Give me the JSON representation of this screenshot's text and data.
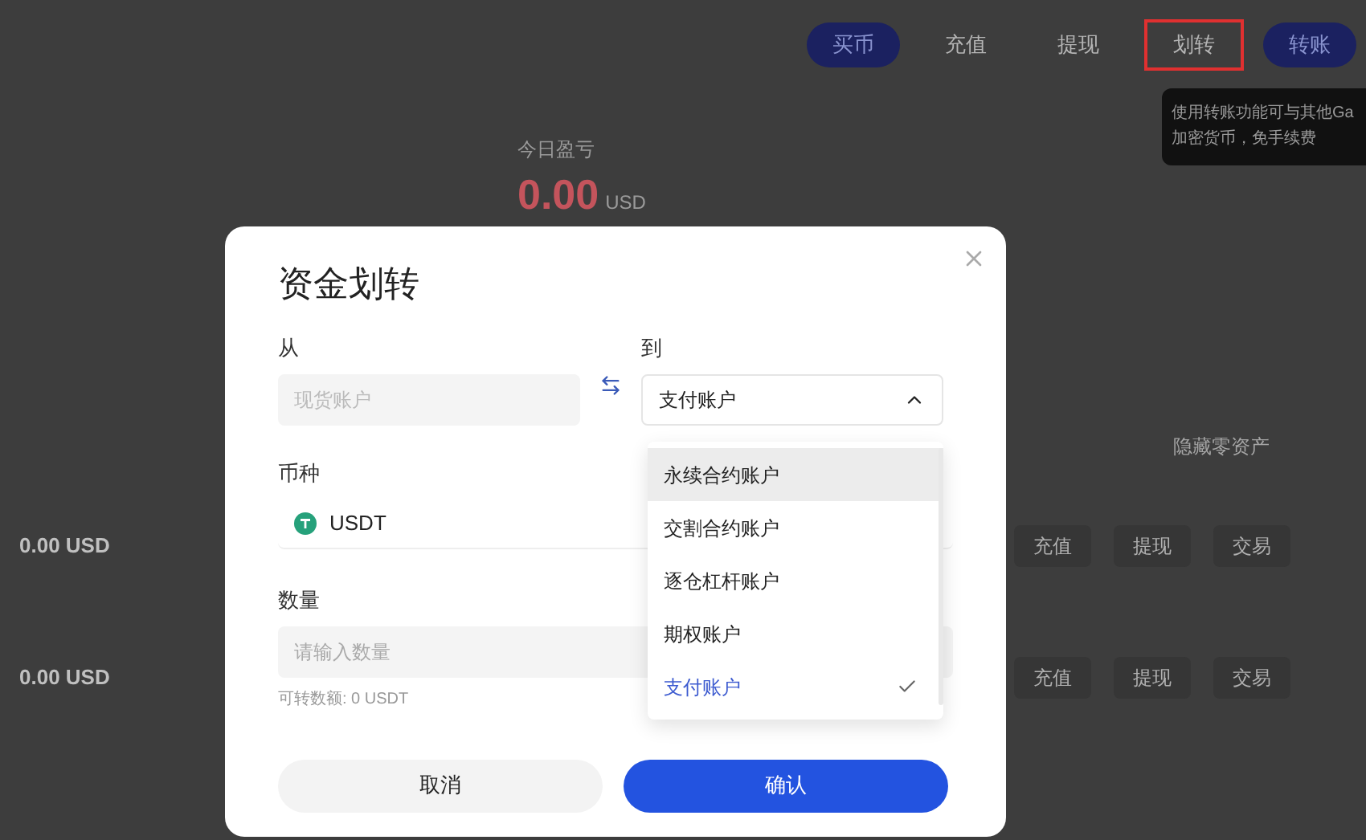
{
  "top_actions": [
    {
      "label": "买币",
      "kind": "primary",
      "highlighted": false
    },
    {
      "label": "充值",
      "kind": "plain",
      "highlighted": false
    },
    {
      "label": "提现",
      "kind": "plain",
      "highlighted": false
    },
    {
      "label": "划转",
      "kind": "plain",
      "highlighted": true
    },
    {
      "label": "转账",
      "kind": "primary",
      "highlighted": false
    }
  ],
  "tooltip": {
    "lines": [
      "使用转账功能可与其他Ga",
      "加密货币，免手续费"
    ]
  },
  "summary": {
    "label": "今日盈亏",
    "value": "0.00",
    "unit": "USD"
  },
  "hide_zero": "隐藏零资产",
  "rows": [
    {
      "amount": "0.00 USD",
      "actions": [
        "充值",
        "提现",
        "交易"
      ]
    },
    {
      "amount": "0.00 USD",
      "actions": [
        "充值",
        "提现",
        "交易"
      ]
    }
  ],
  "dialog": {
    "title": "资金划转",
    "from_label": "从",
    "from_value": "现货账户",
    "to_label": "到",
    "to_value": "支付账户",
    "currency_label": "币种",
    "currency": "USDT",
    "amount_label": "数量",
    "amount_placeholder": "请输入数量",
    "available": "可转数额: 0 USDT",
    "cancel": "取消",
    "confirm": "确认",
    "options": [
      {
        "label": "永续合约账户",
        "hovered": true,
        "selected": false
      },
      {
        "label": "交割合约账户",
        "hovered": false,
        "selected": false
      },
      {
        "label": "逐仓杠杆账户",
        "hovered": false,
        "selected": false
      },
      {
        "label": "期权账户",
        "hovered": false,
        "selected": false
      },
      {
        "label": "支付账户",
        "hovered": false,
        "selected": true
      }
    ]
  }
}
